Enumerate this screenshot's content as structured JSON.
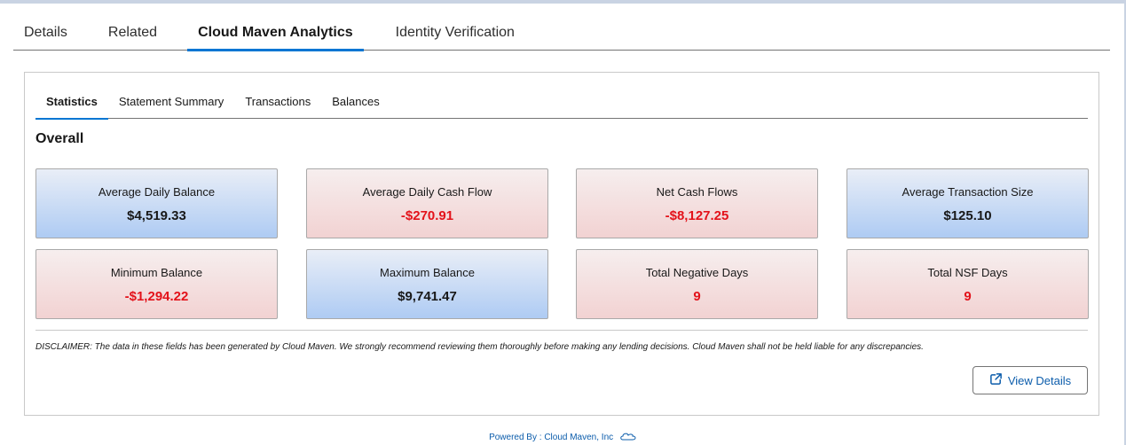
{
  "main_tabs": [
    {
      "label": "Details"
    },
    {
      "label": "Related"
    },
    {
      "label": "Cloud Maven Analytics",
      "active": true
    },
    {
      "label": "Identity Verification"
    }
  ],
  "sub_tabs": [
    {
      "label": "Statistics",
      "active": true
    },
    {
      "label": "Statement Summary"
    },
    {
      "label": "Transactions"
    },
    {
      "label": "Balances"
    }
  ],
  "section_title": "Overall",
  "stats": [
    {
      "label": "Average Daily Balance",
      "value": "$4,519.33",
      "tone": "blue"
    },
    {
      "label": "Average Daily Cash Flow",
      "value": "-$270.91",
      "tone": "red"
    },
    {
      "label": "Net Cash Flows",
      "value": "-$8,127.25",
      "tone": "red"
    },
    {
      "label": "Average Transaction Size",
      "value": "$125.10",
      "tone": "blue"
    },
    {
      "label": "Minimum Balance",
      "value": "-$1,294.22",
      "tone": "red"
    },
    {
      "label": "Maximum Balance",
      "value": "$9,741.47",
      "tone": "blue"
    },
    {
      "label": "Total Negative Days",
      "value": "9",
      "tone": "red"
    },
    {
      "label": "Total NSF Days",
      "value": "9",
      "tone": "red"
    }
  ],
  "disclaimer": "DISCLAIMER: The data in these fields has been generated by Cloud Maven. We strongly recommend reviewing them thoroughly before making any lending decisions. Cloud Maven shall not be held liable for any discrepancies.",
  "view_details_label": "View Details",
  "view_details_icon": "external-link-icon",
  "footer_text": "Powered By : Cloud Maven, Inc",
  "footer_icon": "cloud-icon",
  "colors": {
    "accent": "#0176d3",
    "link": "#0b5cab",
    "negative": "#e3121a"
  }
}
